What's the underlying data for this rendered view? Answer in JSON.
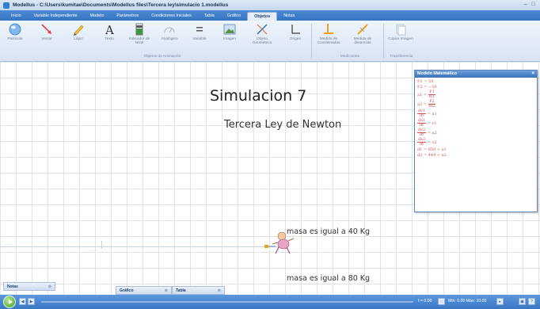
{
  "window": {
    "title": "Modellus - C:\\Users\\kumitae\\Documents\\Modellus files\\Tercera ley\\simulacio 1.modellus",
    "controls": [
      "–",
      "□"
    ]
  },
  "tabs": [
    {
      "label": "Inicio"
    },
    {
      "label": "Variable Independiente"
    },
    {
      "label": "Modelo"
    },
    {
      "label": "Parámetros"
    },
    {
      "label": "Condiciones Iniciales"
    },
    {
      "label": "Tabla"
    },
    {
      "label": "Gráfico"
    },
    {
      "label": "Objetos"
    },
    {
      "label": "Notas"
    }
  ],
  "active_tab": "Objetos",
  "ribbon": {
    "buttons": [
      {
        "label": "Partícula",
        "icon": "particle-icon"
      },
      {
        "label": "Vector",
        "icon": "vector-icon"
      },
      {
        "label": "Lápiz",
        "icon": "pencil-icon"
      },
      {
        "label": "Texto",
        "icon": "text-icon"
      },
      {
        "label": "Indicador de Nivel",
        "icon": "level-indicator-icon"
      },
      {
        "label": "Analógico",
        "icon": "analog-icon"
      },
      {
        "label": "Variable",
        "icon": "variable-icon"
      },
      {
        "label": "Imagen",
        "icon": "image-icon"
      },
      {
        "label": "Objeto Geométrico",
        "icon": "geometric-object-icon"
      },
      {
        "label": "Origen",
        "icon": "origin-icon"
      },
      {
        "label": "Medida de Coordenadas",
        "icon": "coordinate-measure-icon"
      },
      {
        "label": "Medida de distancias",
        "icon": "distance-measure-icon"
      },
      {
        "label": "Copiar Imagen",
        "icon": "copy-image-icon"
      }
    ],
    "group_labels": {
      "animation": "Objetos de Animación",
      "measurements": "Mediciones",
      "transfer": "Transferencia"
    }
  },
  "canvas": {
    "title": "Simulacion 7",
    "subtitle": "Tercera Ley de Newton",
    "mass1_label": "masa es igual a 40 Kg",
    "mass2_label": "masa es igual a 80 Kg"
  },
  "math_model": {
    "title": "Modelo Matemático",
    "close": "×",
    "equations": [
      {
        "kind": "plain",
        "text": "F1 = 50"
      },
      {
        "kind": "plain",
        "text": "F2 = −50"
      },
      {
        "kind": "frac",
        "lhs": "a1 =",
        "num": "F1",
        "den": "m1"
      },
      {
        "kind": "frac",
        "lhs": "a2 =",
        "num": "F2",
        "den": "m2"
      },
      {
        "kind": "deriv",
        "num": "dv1",
        "den": "dt",
        "rhs": "= a1"
      },
      {
        "kind": "deriv",
        "num": "dx1",
        "den": "dt",
        "rhs": "= v1"
      },
      {
        "kind": "deriv",
        "num": "dv2",
        "den": "dt",
        "rhs": "= a2"
      },
      {
        "kind": "deriv",
        "num": "dx2",
        "den": "dt",
        "rhs": "= v2"
      },
      {
        "kind": "plain",
        "text": "d1 = 850 + x1"
      },
      {
        "kind": "plain",
        "text": "d2 = 444 + x2"
      }
    ]
  },
  "dock": {
    "notas": "Notas",
    "grafico": "Gráfico",
    "tabla": "Tabla"
  },
  "statusbar": {
    "time_text": "t = 0.00",
    "range_text": "Min: 0.00 Máx: 10.00"
  },
  "colors": {
    "accent": "#3a77c4",
    "equation": "#d24f4f"
  }
}
